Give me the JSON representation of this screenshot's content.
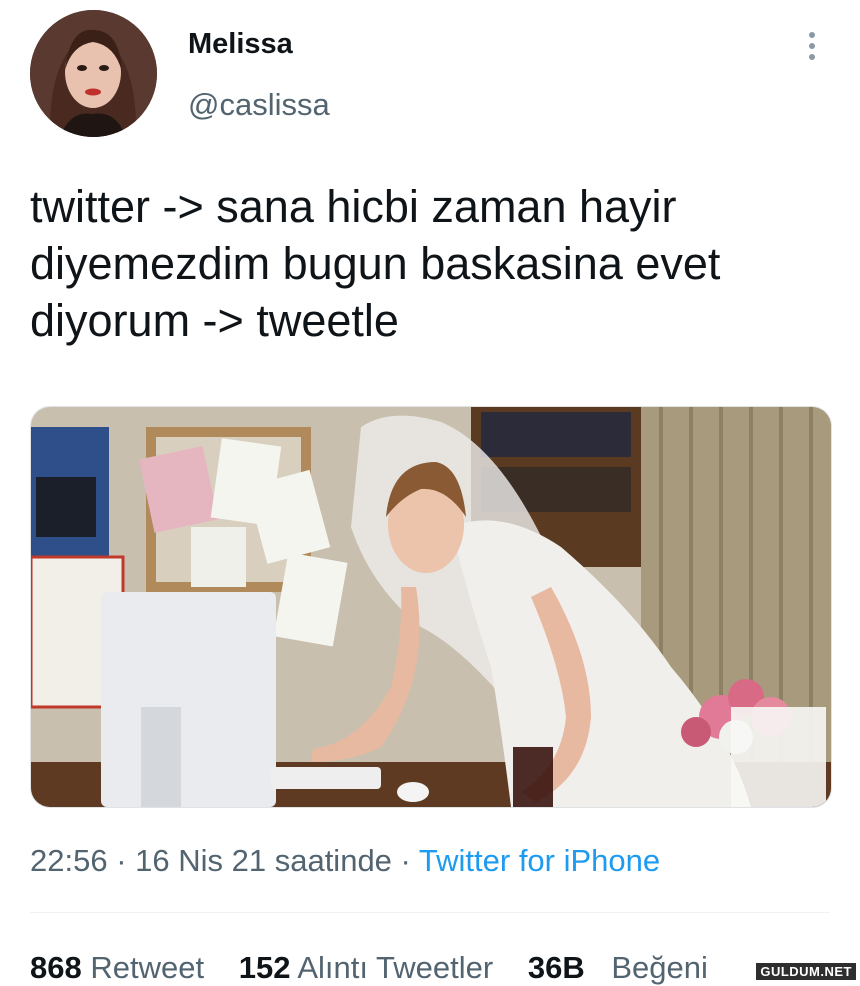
{
  "author": {
    "name": "Melissa",
    "handle": "@caslissa",
    "avatar_icon": "profile-photo"
  },
  "tweet": {
    "text": "twitter -> sana hicbi zaman hayir diyemezdim bugun baskasina evet diyorum -> tweetle",
    "media_icon": "photo-bride-at-computer",
    "time": "22:56",
    "sep1": " · ",
    "date": "16 Nis 21 saatinde",
    "sep2": " · ",
    "source": "Twitter for iPhone"
  },
  "stats": {
    "retweets_count": "868",
    "retweets_label": "Retweet",
    "quotes_count": "152",
    "quotes_label": "Alıntı Tweetler",
    "likes_count": "36B",
    "likes_label": "Beğeni"
  },
  "watermark": "GULDUM.NET",
  "colors": {
    "text": "#0f1419",
    "secondary": "#536471",
    "link": "#1d9bf0"
  }
}
